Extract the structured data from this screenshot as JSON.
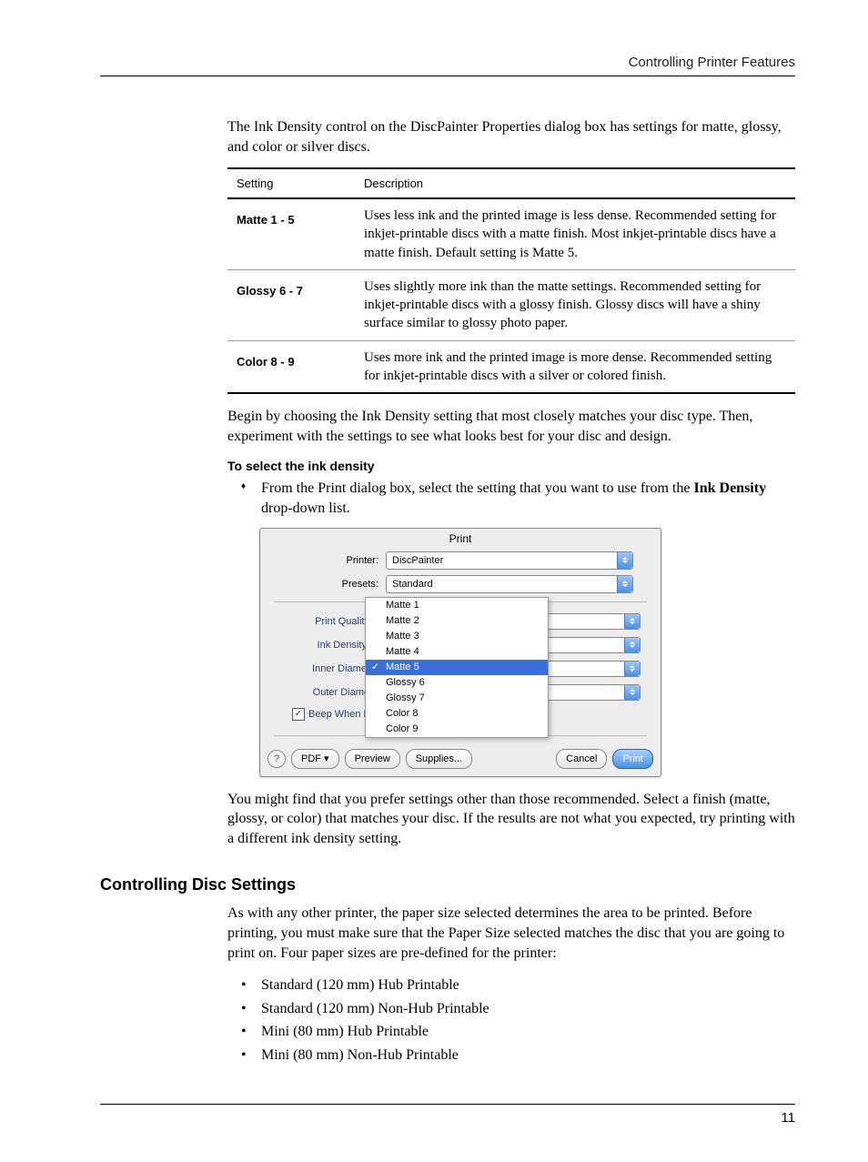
{
  "header": "Controlling Printer Features",
  "intro": "The Ink Density control on the DiscPainter Properties dialog box has settings for matte, glossy, and color or silver discs.",
  "table": {
    "col1": "Setting",
    "col2": "Description",
    "rows": [
      {
        "setting": "Matte 1 - 5",
        "desc": "Uses less ink and the printed image is less dense. Recommended setting for inkjet-printable discs with a matte finish. Most inkjet-printable discs have a matte finish. Default setting is Matte 5."
      },
      {
        "setting": "Glossy 6 - 7",
        "desc": "Uses slightly more ink than the matte settings. Recommended setting for inkjet-printable discs with a glossy finish. Glossy discs will have a shiny surface similar to glossy photo paper."
      },
      {
        "setting": "Color 8 - 9",
        "desc": "Uses more ink and the printed image is more dense. Recommended setting for inkjet-printable discs with a silver or colored finish."
      }
    ]
  },
  "after_table": "Begin by choosing the Ink Density setting that most closely matches your disc type. Then, experiment with the settings to see what looks best for your disc and design.",
  "subhead": "To select the ink density",
  "step": {
    "pre": "From the Print dialog box, select the setting that you want to use from the ",
    "bold": "Ink Density",
    "post": " drop-down list."
  },
  "dialog": {
    "title": "Print",
    "printer_label": "Printer:",
    "printer_value": "DiscPainter",
    "presets_label": "Presets:",
    "presets_value": "Standard",
    "print_quality_label": "Print Quality",
    "ink_density_label": "Ink Density:",
    "inner_diameter_label": "Inner Diamet",
    "outer_diameter_label": "Outer Diame",
    "beep_label": "Beep When Finished Printing",
    "options": [
      "Matte 1",
      "Matte 2",
      "Matte 3",
      "Matte 4",
      "Matte 5",
      "Glossy 6",
      "Glossy 7",
      "Color 8",
      "Color 9"
    ],
    "selected_option": "Matte 5",
    "help": "?",
    "pdf": "PDF ▾",
    "preview": "Preview",
    "supplies": "Supplies...",
    "cancel": "Cancel",
    "print": "Print"
  },
  "after_dialog": "You might find that you prefer settings other than those recommended. Select a finish (matte, glossy, or color) that matches your disc. If the results are not what you expected, try printing with a different ink density setting.",
  "section2": {
    "title": "Controlling Disc Settings",
    "intro": "As with any other printer, the paper size selected determines the area to be printed. Before printing, you must make sure that the Paper Size selected matches the disc that you are going to print on. Four paper sizes are pre-defined for the printer:",
    "items": [
      "Standard (120 mm) Hub Printable",
      "Standard (120 mm) Non-Hub Printable",
      "Mini (80 mm) Hub Printable",
      "Mini (80 mm) Non-Hub Printable"
    ]
  },
  "page_number": "11"
}
